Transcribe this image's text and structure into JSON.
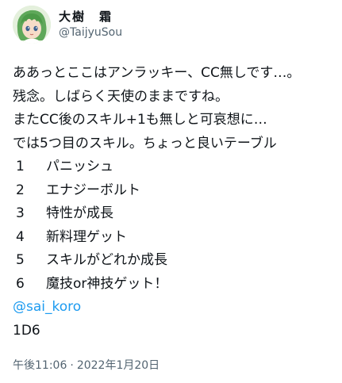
{
  "user": {
    "display_name": "大樹　霜",
    "handle": "@TaijyuSou",
    "avatar_icon": "anime-avatar-icon"
  },
  "tweet": {
    "lines": [
      "ああっとここはアンラッキー、CC無しです…。",
      "残念。しばらく天使のままですね。",
      "またCC後のスキル+1も無しと可哀想に…",
      "では5つ目のスキル。ちょっと良いテーブル"
    ],
    "list": [
      {
        "num": "1",
        "text": "パニッシュ"
      },
      {
        "num": "2",
        "text": "エナジーボルト"
      },
      {
        "num": "3",
        "text": "特性が成長"
      },
      {
        "num": "4",
        "text": "新料理ゲット"
      },
      {
        "num": "5",
        "text": "スキルがどれか成長"
      },
      {
        "num": "6",
        "text": "魔技or神技ゲット！"
      }
    ],
    "mention": "@sai_koro",
    "dice": "1D6"
  },
  "meta": {
    "time": "午後11:06",
    "separator": "·",
    "date": "2022年1月20日"
  }
}
